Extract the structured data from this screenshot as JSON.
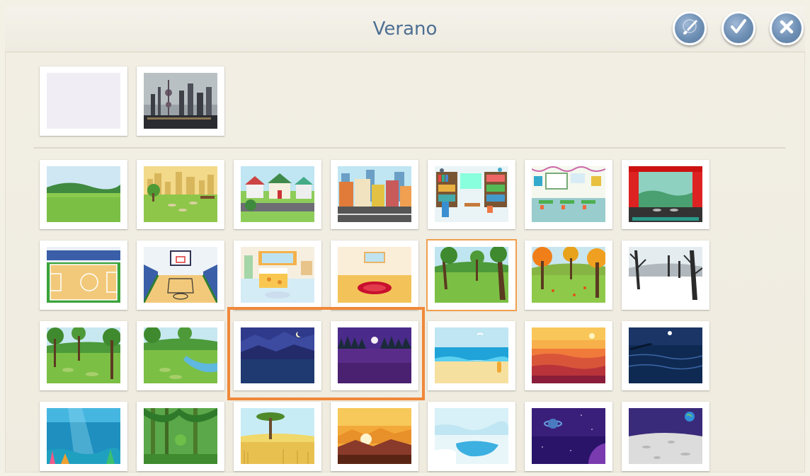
{
  "header": {
    "title": "Verano",
    "buttons": [
      {
        "name": "paint-button",
        "icon": "paintbrush-icon"
      },
      {
        "name": "confirm-button",
        "icon": "checkmark-icon"
      },
      {
        "name": "close-button",
        "icon": "close-icon"
      }
    ]
  },
  "colors": {
    "title": "#4e6f93",
    "button": "#6e8fb4",
    "highlight": "#f0883a",
    "selected_outline": "#f0a050"
  },
  "custom_backgrounds": [
    {
      "name": "blank-background",
      "scene": "blank"
    },
    {
      "name": "city-photo-background",
      "scene": "photo-city"
    }
  ],
  "backgrounds": [
    {
      "name": "meadow",
      "scene": "meadow"
    },
    {
      "name": "city-park",
      "scene": "citypark"
    },
    {
      "name": "suburb-street",
      "scene": "suburb"
    },
    {
      "name": "city-street",
      "scene": "citystreet"
    },
    {
      "name": "library",
      "scene": "library"
    },
    {
      "name": "classroom",
      "scene": "classroom"
    },
    {
      "name": "theater-stage",
      "scene": "theater"
    },
    {
      "name": "basketball-court-side",
      "scene": "court1"
    },
    {
      "name": "basketball-court-front",
      "scene": "court2"
    },
    {
      "name": "bedroom",
      "scene": "bedroom"
    },
    {
      "name": "empty-room",
      "scene": "room"
    },
    {
      "name": "forest-summer",
      "scene": "forest",
      "selected": true
    },
    {
      "name": "forest-autumn",
      "scene": "autumn"
    },
    {
      "name": "forest-winter",
      "scene": "winter"
    },
    {
      "name": "park-trees",
      "scene": "park"
    },
    {
      "name": "park-stream",
      "scene": "stream"
    },
    {
      "name": "night-mountains",
      "scene": "nightmtn",
      "highlighted": true
    },
    {
      "name": "night-forest",
      "scene": "nightforest",
      "highlighted": true
    },
    {
      "name": "beach",
      "scene": "beach"
    },
    {
      "name": "sunset-sea",
      "scene": "sunset"
    },
    {
      "name": "night-sea",
      "scene": "nightsea"
    },
    {
      "name": "underwater",
      "scene": "underwater"
    },
    {
      "name": "jungle",
      "scene": "jungle"
    },
    {
      "name": "savanna",
      "scene": "savanna"
    },
    {
      "name": "desert-sunrise",
      "scene": "desert"
    },
    {
      "name": "arctic",
      "scene": "arctic"
    },
    {
      "name": "outer-space",
      "scene": "space"
    },
    {
      "name": "moon-surface",
      "scene": "moon"
    }
  ]
}
